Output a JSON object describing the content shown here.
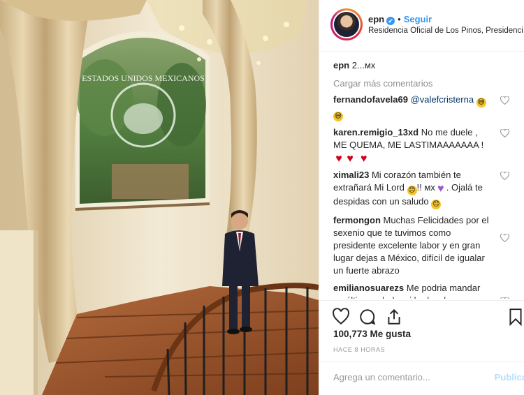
{
  "post": {
    "username": "epn",
    "verified_mark": "✔",
    "separator": "•",
    "follow_label": "Seguir",
    "location": "Residencia Oficial de Los Pinos, Presidencia..."
  },
  "caption": {
    "username": "epn",
    "text": "2...мх"
  },
  "load_more_label": "Cargar más comentarios",
  "comments": [
    {
      "user": "fernandofavela69",
      "mention": "@valefcristerna",
      "text": ""
    },
    {
      "user": "karen.remigio_13xd",
      "text": "No me duele , ME QUEMA, ME LASTIMAAAAAAA !"
    },
    {
      "user": "ximali23",
      "text_a": "Mi corazón también te extrañará Mi Lord",
      "text_b": "!! мх",
      "text_c": ". Ojalá te despidas con un saludo"
    },
    {
      "user": "fermongon",
      "text": "Muchas Felicidades por el sexenio que te tuvimos como presidente excelente labor y en gran lugar dejas a México, difícil de igualar un fuerte abrazo"
    },
    {
      "user": "emilianosuarezs",
      "text": "Me podria mandar un último saludo mi lord,se le va a extrañar y como usted han habido"
    }
  ],
  "likes_label": "100,773 Me gusta",
  "timestamp": "HACE 8 HORAS",
  "add_comment": {
    "placeholder": "Agrega un comentario...",
    "post_label": "Publicar"
  },
  "photo": {
    "window_text": "ESTADOS UNIDOS MEXICANOS"
  },
  "icons": [
    "heart-icon",
    "comment-icon",
    "share-icon",
    "bookmark-icon",
    "heart-small-icon",
    "verified-icon"
  ],
  "colors": {
    "link_blue": "#3897f0",
    "mention_blue": "#003569",
    "muted_gray": "#8e8e8e",
    "heart_red": "#d0021b"
  }
}
